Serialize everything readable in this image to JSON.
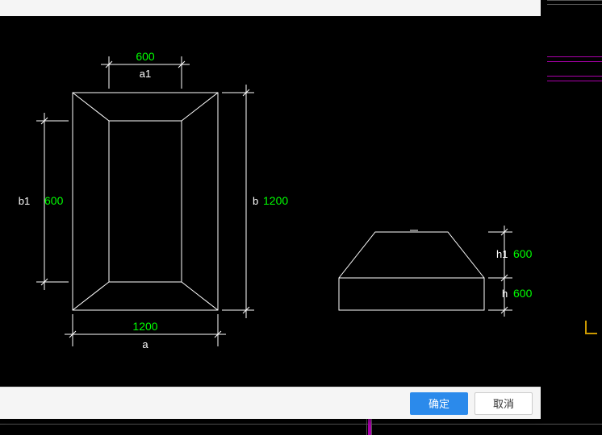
{
  "dims": {
    "a": {
      "label": "a",
      "value": "1200"
    },
    "a1": {
      "label": "a1",
      "value": "600"
    },
    "b": {
      "label": "b",
      "value": "1200"
    },
    "b1": {
      "label": "b1",
      "value": "600"
    },
    "h": {
      "label": "h",
      "value": "600"
    },
    "h1": {
      "label": "h1",
      "value": "600"
    }
  },
  "buttons": {
    "ok": "确定",
    "cancel": "取消"
  }
}
